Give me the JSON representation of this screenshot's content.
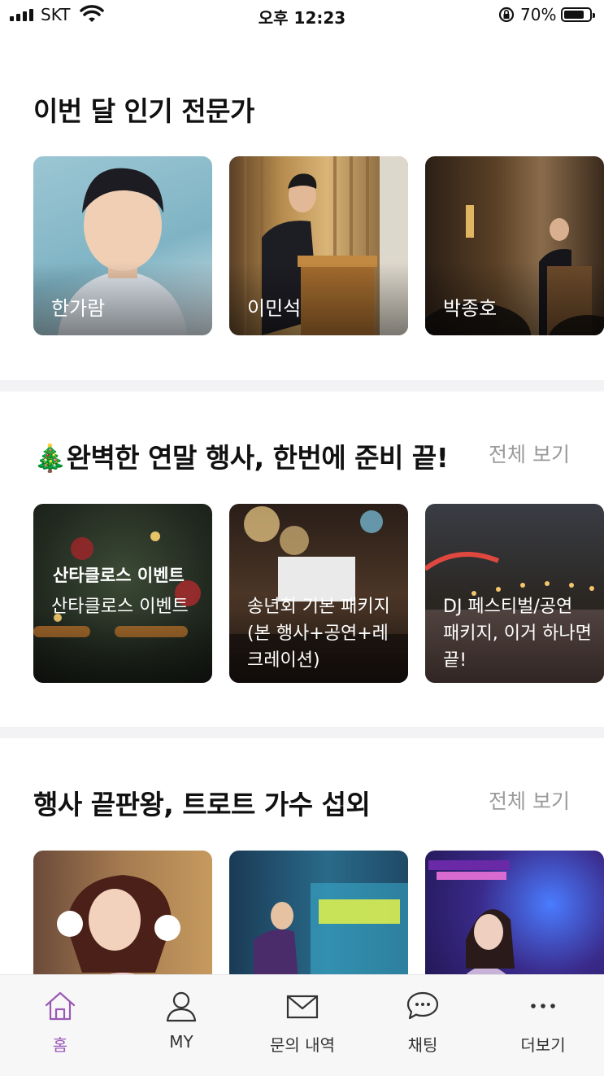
{
  "status_bar": {
    "carrier": "SKT",
    "time": "오후 12:23",
    "battery": "70%"
  },
  "sections": [
    {
      "title": "이번 달 인기 전문가",
      "cards": [
        {
          "name": "한가람"
        },
        {
          "name": "이민석"
        },
        {
          "name": "박종호"
        }
      ]
    },
    {
      "title": "🎄완벽한 연말 행사, 한번에 준비 끝!",
      "see_all": "전체 보기",
      "cards": [
        {
          "overlay": "산타클로스 이벤트",
          "text": "산타클로스 이벤트"
        },
        {
          "text": "송년회 기본 패키지 (본 행사+공연+레크레이션)"
        },
        {
          "text": "DJ 페스티벌/공연 패키지, 이거 하나면 끝!"
        }
      ]
    },
    {
      "title": "행사 끝판왕, 트로트 가수 섭외",
      "see_all": "전체 보기",
      "cards": [
        {
          "text": ""
        },
        {
          "text": ""
        },
        {
          "text": ""
        }
      ]
    }
  ],
  "tabbar": [
    {
      "label": "홈",
      "icon": "home-icon",
      "active": true
    },
    {
      "label": "MY",
      "icon": "person-icon",
      "active": false
    },
    {
      "label": "문의 내역",
      "icon": "mail-icon",
      "active": false
    },
    {
      "label": "채팅",
      "icon": "chat-bubble-icon",
      "active": false
    },
    {
      "label": "더보기",
      "icon": "more-dots-icon",
      "active": false
    }
  ],
  "colors": {
    "accent": "#9b59b6",
    "muted_text": "#9a9a9a",
    "divider": "#f3f3f5"
  }
}
